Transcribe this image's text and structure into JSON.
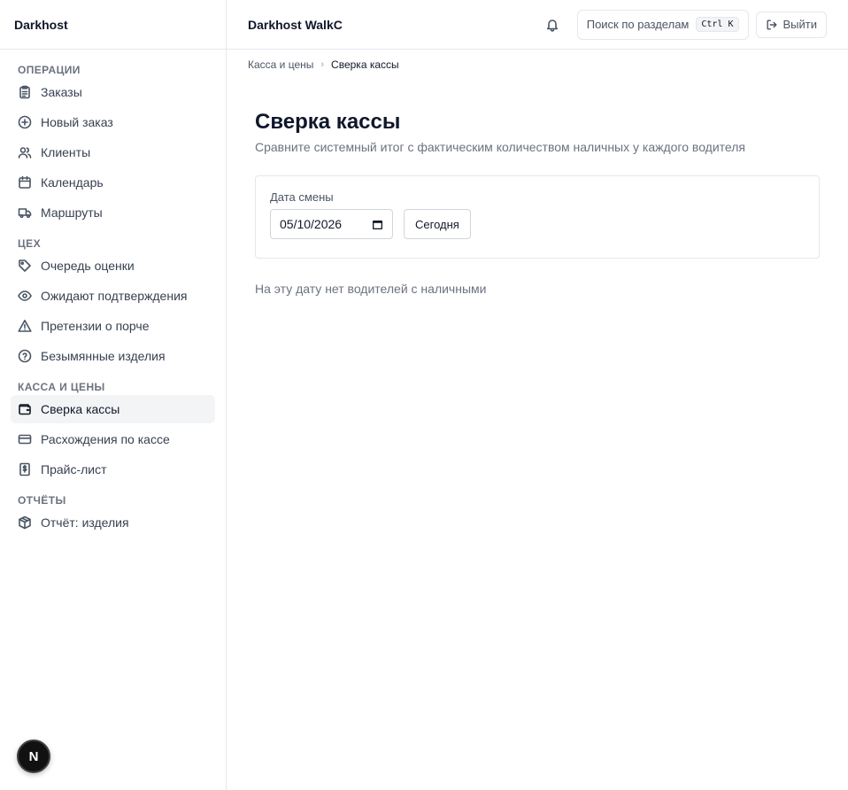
{
  "sidebar": {
    "brand": "Darkhost",
    "sections": [
      {
        "heading": "ОПЕРАЦИИ",
        "items": [
          {
            "label": "Заказы",
            "icon": "clipboard-icon"
          },
          {
            "label": "Новый заказ",
            "icon": "plus-circle-icon"
          },
          {
            "label": "Клиенты",
            "icon": "users-icon"
          },
          {
            "label": "Календарь",
            "icon": "calendar-icon"
          },
          {
            "label": "Маршруты",
            "icon": "truck-icon"
          }
        ]
      },
      {
        "heading": "ЦЕХ",
        "items": [
          {
            "label": "Очередь оценки",
            "icon": "tag-icon"
          },
          {
            "label": "Ожидают подтверждения",
            "icon": "eye-icon"
          },
          {
            "label": "Претензии о порче",
            "icon": "warning-triangle-icon"
          },
          {
            "label": "Безымянные изделия",
            "icon": "help-circle-icon"
          }
        ]
      },
      {
        "heading": "КАССА И ЦЕНЫ",
        "items": [
          {
            "label": "Сверка кассы",
            "icon": "wallet-icon",
            "active": true
          },
          {
            "label": "Расхождения по кассе",
            "icon": "credit-card-icon"
          },
          {
            "label": "Прайс-лист",
            "icon": "dollar-receipt-icon"
          }
        ]
      },
      {
        "heading": "ОТЧЁТЫ",
        "items": [
          {
            "label": "Отчёт: изделия",
            "icon": "package-icon"
          }
        ]
      }
    ]
  },
  "header": {
    "title": "Darkhost WalkC",
    "search_label": "Поиск по разделам",
    "search_shortcut": "Ctrl K",
    "logout_label": "Выйти"
  },
  "breadcrumb": {
    "parent": "Касса и цены",
    "current": "Сверка кассы"
  },
  "page": {
    "title": "Сверка кассы",
    "subtitle": "Сравните системный итог с фактическим количеством наличных у каждого водителя",
    "date_label": "Дата смены",
    "date_value": "05/10/2026",
    "today_button": "Сегодня",
    "empty_message": "На эту дату нет водителей с наличными"
  },
  "badge": {
    "letter": "N"
  },
  "colors": {
    "active_bg": "#f3f4f6",
    "border": "#e5e7eb",
    "muted_text": "#6b7280"
  }
}
